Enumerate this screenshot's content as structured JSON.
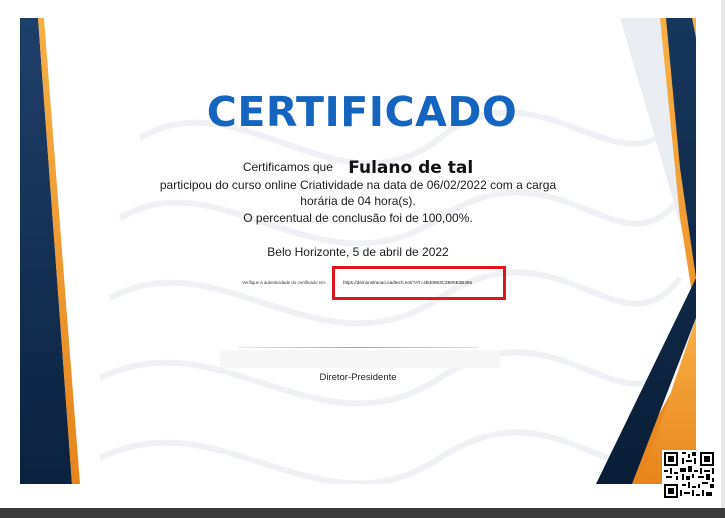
{
  "certificate": {
    "title": "CERTIFICADO",
    "lead": "Certificamos que",
    "name": "Fulano de tal",
    "body_line1": "participou do curso online Criatividade na data de 06/02/2022 com a carga",
    "body_line2": "horária de 04 hora(s).",
    "body_line3": "O percentual de conclusão foi de 100,00%.",
    "place_date": "Belo Horizonte, 5 de abril de 2022",
    "verify_label": "Verifique a autenticidade do certificado em:",
    "verify_url": "https://demonstracao.eadtech.net/?AT=4B40863C2B05B3B465",
    "signer_role": "Diretor-Presidente"
  },
  "colors": {
    "title_blue": "#1565c0",
    "navy": "#0f2a4a",
    "orange": "#f39a2b",
    "highlight_red": "#e0161e"
  },
  "icons": [
    "qr-code-icon"
  ]
}
